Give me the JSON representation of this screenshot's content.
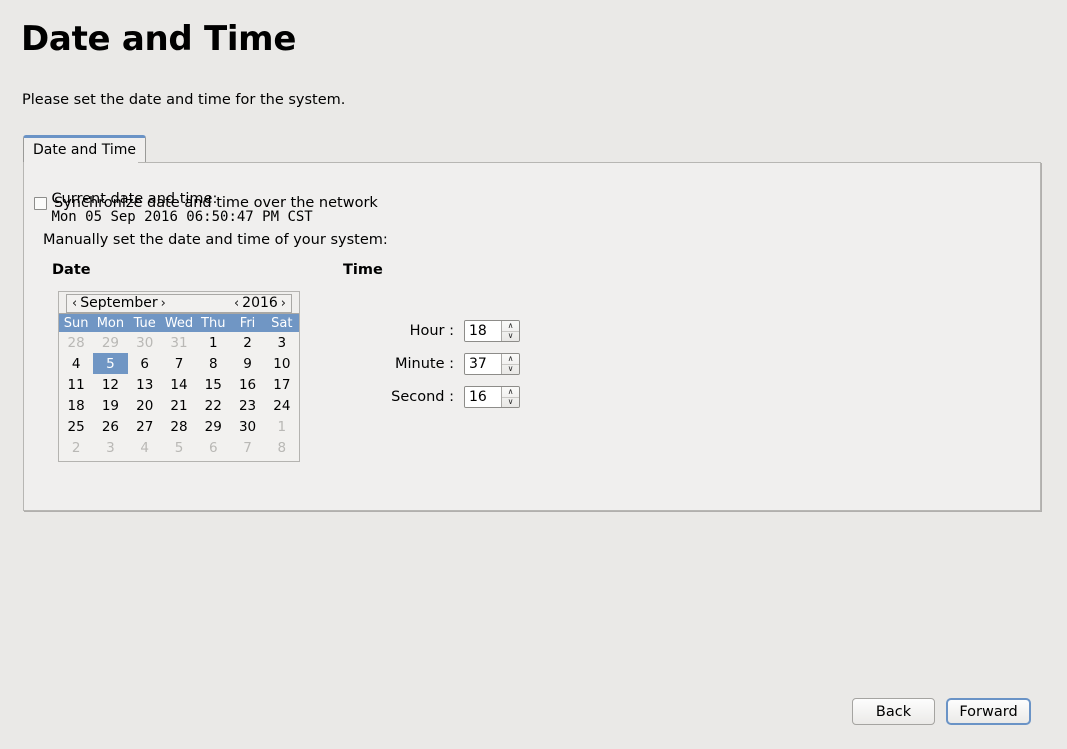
{
  "page": {
    "title": "Date and Time",
    "subtitle": "Please set the date and time for the system."
  },
  "tabs": [
    {
      "label": "Date and Time",
      "active": true
    }
  ],
  "panel": {
    "current_label": "Current date and time:",
    "current_value": "Mon 05 Sep 2016 06:50:47 PM CST",
    "sync_checkbox_label": "Synchronize date and time over the network",
    "sync_checked": false,
    "manual_label": "Manually set the date and time of your system:",
    "date_section_title": "Date",
    "time_section_title": "Time"
  },
  "calendar": {
    "month": "September",
    "year": "2016",
    "prev_month_arrow": "‹",
    "next_month_arrow": "›",
    "prev_year_arrow": "‹",
    "next_year_arrow": "›",
    "weekdays": [
      "Sun",
      "Mon",
      "Tue",
      "Wed",
      "Thu",
      "Fri",
      "Sat"
    ],
    "selected_day": 5,
    "header_color": "#7096c4",
    "selected_color": "#7096c4",
    "weeks": [
      [
        {
          "d": "28",
          "out": true
        },
        {
          "d": "29",
          "out": true
        },
        {
          "d": "30",
          "out": true
        },
        {
          "d": "31",
          "out": true
        },
        {
          "d": "1",
          "out": false
        },
        {
          "d": "2",
          "out": false
        },
        {
          "d": "3",
          "out": false
        }
      ],
      [
        {
          "d": "4",
          "out": false
        },
        {
          "d": "5",
          "out": false,
          "sel": true
        },
        {
          "d": "6",
          "out": false
        },
        {
          "d": "7",
          "out": false
        },
        {
          "d": "8",
          "out": false
        },
        {
          "d": "9",
          "out": false
        },
        {
          "d": "10",
          "out": false
        }
      ],
      [
        {
          "d": "11",
          "out": false
        },
        {
          "d": "12",
          "out": false
        },
        {
          "d": "13",
          "out": false
        },
        {
          "d": "14",
          "out": false
        },
        {
          "d": "15",
          "out": false
        },
        {
          "d": "16",
          "out": false
        },
        {
          "d": "17",
          "out": false
        }
      ],
      [
        {
          "d": "18",
          "out": false
        },
        {
          "d": "19",
          "out": false
        },
        {
          "d": "20",
          "out": false
        },
        {
          "d": "21",
          "out": false
        },
        {
          "d": "22",
          "out": false
        },
        {
          "d": "23",
          "out": false
        },
        {
          "d": "24",
          "out": false
        }
      ],
      [
        {
          "d": "25",
          "out": false
        },
        {
          "d": "26",
          "out": false
        },
        {
          "d": "27",
          "out": false
        },
        {
          "d": "28",
          "out": false
        },
        {
          "d": "29",
          "out": false
        },
        {
          "d": "30",
          "out": false
        },
        {
          "d": "1",
          "out": true
        }
      ],
      [
        {
          "d": "2",
          "out": true
        },
        {
          "d": "3",
          "out": true
        },
        {
          "d": "4",
          "out": true
        },
        {
          "d": "5",
          "out": true
        },
        {
          "d": "6",
          "out": true
        },
        {
          "d": "7",
          "out": true
        },
        {
          "d": "8",
          "out": true
        }
      ]
    ]
  },
  "time": {
    "hour_label": "Hour :",
    "hour_value": "18",
    "minute_label": "Minute :",
    "minute_value": "37",
    "second_label": "Second :",
    "second_value": "16",
    "up_arrow": "∧",
    "down_arrow": "∨"
  },
  "footer": {
    "back_label": "Back",
    "forward_label": "Forward",
    "forward_focus_color": "#6a93c6"
  }
}
